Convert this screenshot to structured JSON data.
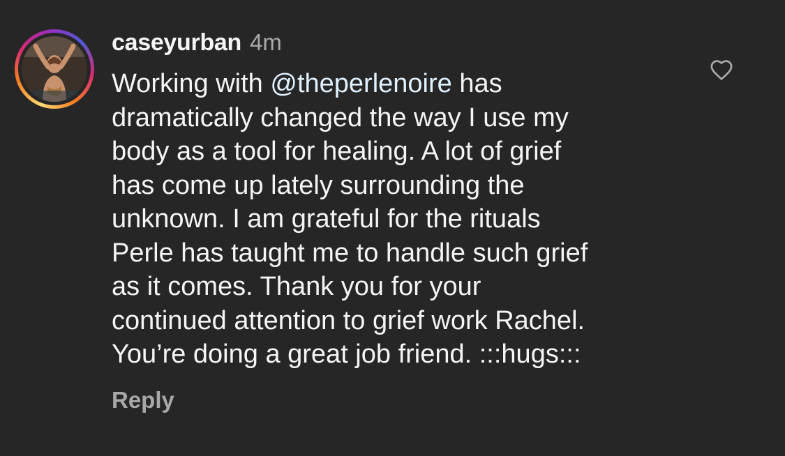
{
  "comment": {
    "username": "caseyurban",
    "timestamp": "4m",
    "lines": [
      {
        "before": "Working with ",
        "mention": "@theperlenoire",
        "after": " has"
      },
      {
        "text": "dramatically changed the way I use my"
      },
      {
        "text": "body as a tool for healing. A lot of grief"
      },
      {
        "text": "has come up lately surrounding the"
      },
      {
        "text": "unknown. I am grateful for the rituals"
      },
      {
        "text": "Perle has taught me to handle such grief"
      },
      {
        "text": "as it comes. Thank you for your"
      },
      {
        "text": "continued attention to grief work Rachel."
      },
      {
        "text": "You’re doing a great job friend. :::hugs:::"
      }
    ],
    "reply_label": "Reply",
    "like_icon": "heart-outline-icon",
    "avatar_ring_colors": [
      "#feda75",
      "#fa7e1e",
      "#d62976",
      "#962fbf",
      "#4f5bd5"
    ]
  },
  "theme": {
    "background": "#262626",
    "text": "#f5f5f5",
    "secondary_text": "#a8a8a8",
    "mention": "#e0f1ff"
  }
}
